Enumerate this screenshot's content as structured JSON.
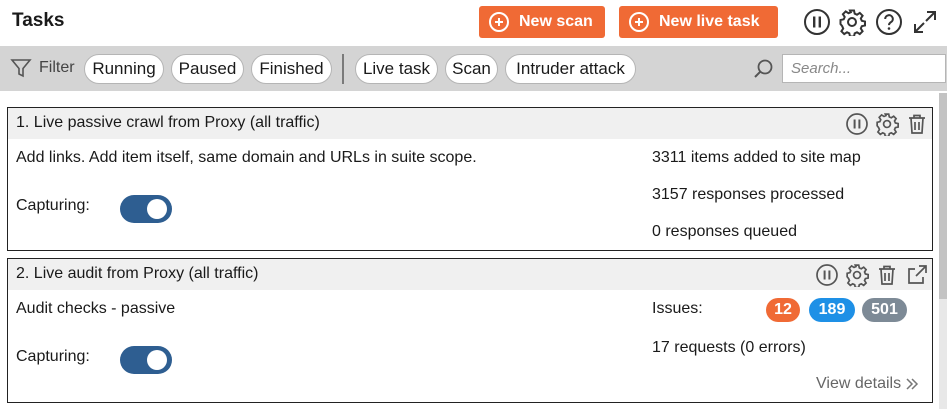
{
  "header": {
    "title": "Tasks",
    "new_scan_label": "New scan",
    "new_live_task_label": "New live task",
    "accent": "#f06a35"
  },
  "filter": {
    "label": "Filter",
    "chips": [
      "Running",
      "Paused",
      "Finished",
      "Live task",
      "Scan",
      "Intruder attack"
    ],
    "search_placeholder": "Search..."
  },
  "tasks": [
    {
      "title": "1. Live passive crawl from Proxy (all traffic)",
      "description": "Add links. Add item itself, same domain and URLs in suite scope.",
      "capturing_label": "Capturing:",
      "capturing_on": true,
      "stats": [
        "3311 items added to site map",
        "3157 responses processed",
        "0 responses queued"
      ],
      "icons": [
        "pause-icon",
        "gear-icon",
        "trash-icon"
      ]
    },
    {
      "title": "2. Live audit from Proxy (all traffic)",
      "description": "Audit checks - passive",
      "capturing_label": "Capturing:",
      "capturing_on": true,
      "issues_label": "Issues:",
      "issues": [
        {
          "count": "12",
          "color": "#f06a35"
        },
        {
          "count": "189",
          "color": "#1e90e6"
        },
        {
          "count": "501",
          "color": "#7d8a96"
        }
      ],
      "requests": "17 requests (0 errors)",
      "view_details": "View details",
      "icons": [
        "pause-icon",
        "gear-icon",
        "trash-icon",
        "external-link-icon"
      ]
    }
  ],
  "colors": {
    "toggle": "#2e5e91",
    "filter_bar": "#d4d4d4"
  }
}
